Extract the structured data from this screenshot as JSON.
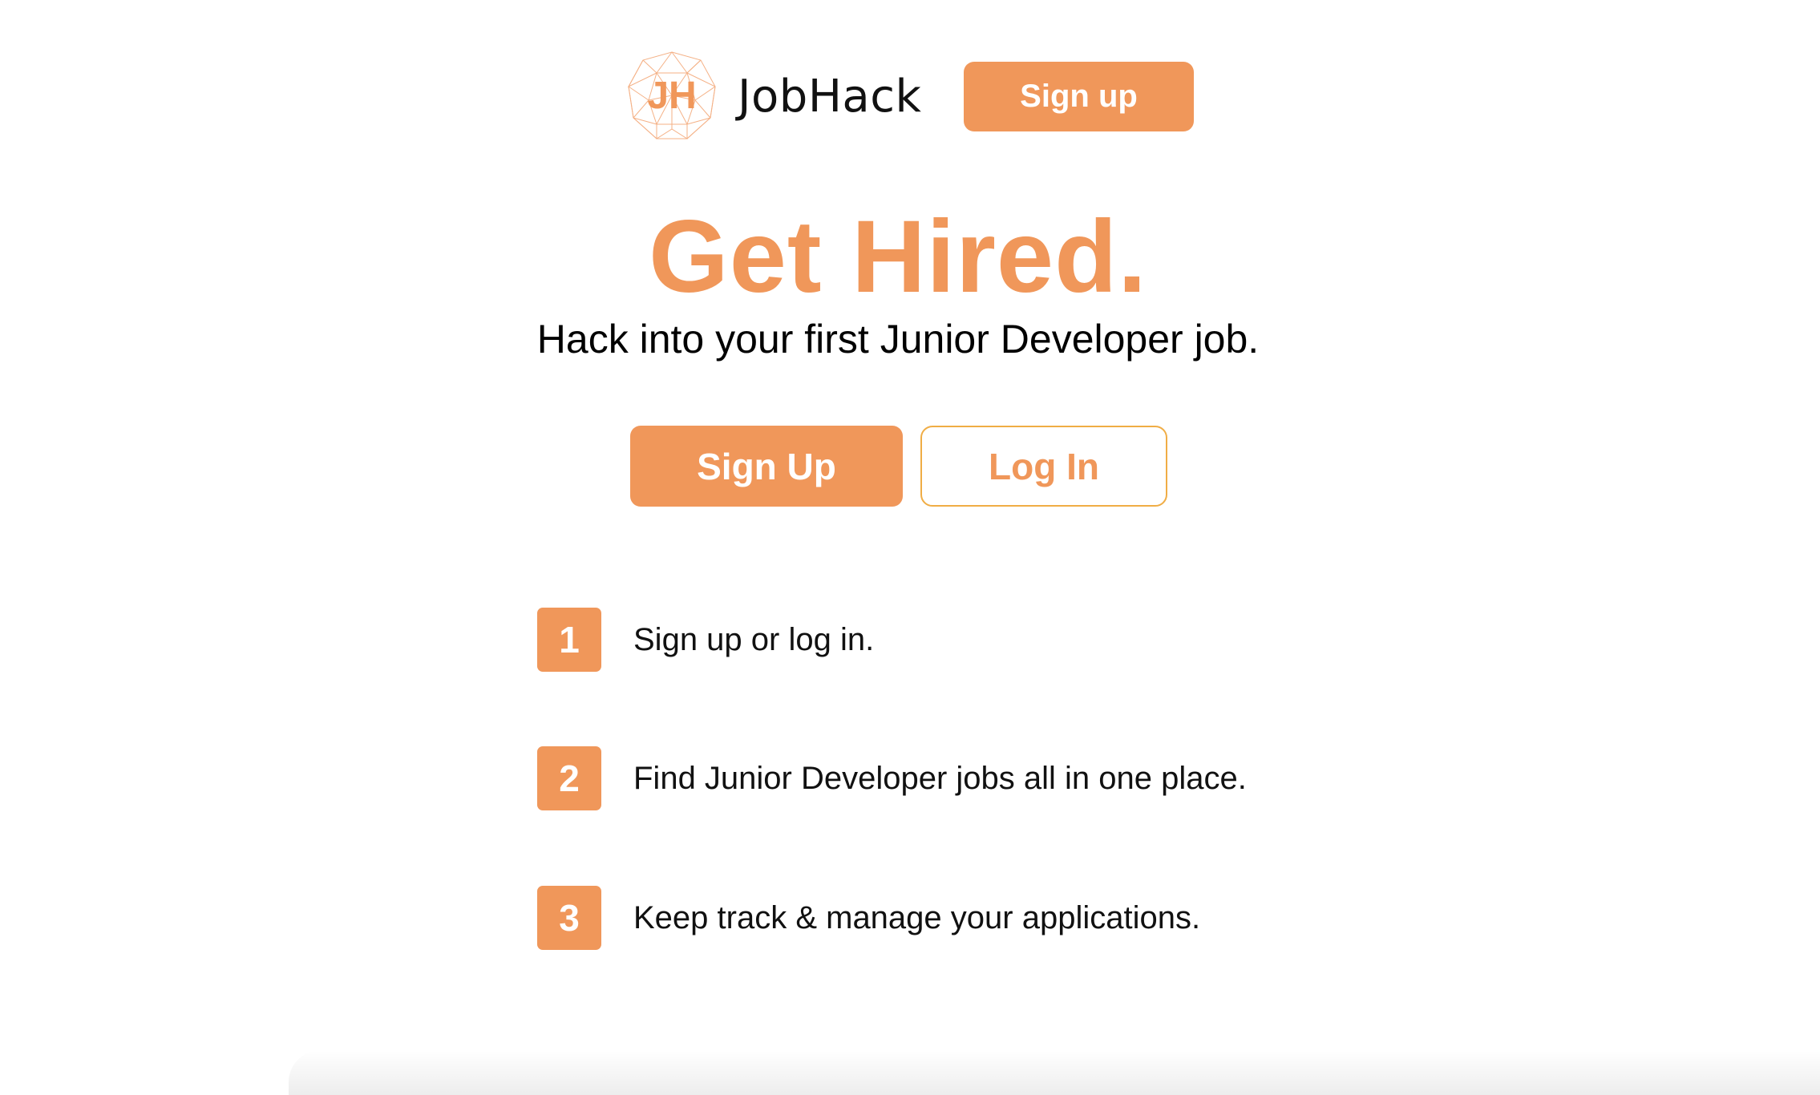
{
  "brand": {
    "logo_letters": "JH",
    "name": "JobHack"
  },
  "header": {
    "signup_label": "Sign up"
  },
  "hero": {
    "title": "Get Hired.",
    "subtitle": "Hack into your first Junior Developer job."
  },
  "cta": {
    "signup_label": "Sign Up",
    "login_label": "Log In"
  },
  "steps": [
    {
      "number": "1",
      "text": "Sign up or log in."
    },
    {
      "number": "2",
      "text": "Find Junior Developer jobs all in one place."
    },
    {
      "number": "3",
      "text": "Keep track & manage your applications."
    }
  ],
  "colors": {
    "accent": "#f0975a",
    "login_border": "#f0ad45",
    "text": "#000000",
    "background": "#ffffff"
  },
  "icons": {
    "logo": "geodesic-sphere-logo-icon"
  }
}
